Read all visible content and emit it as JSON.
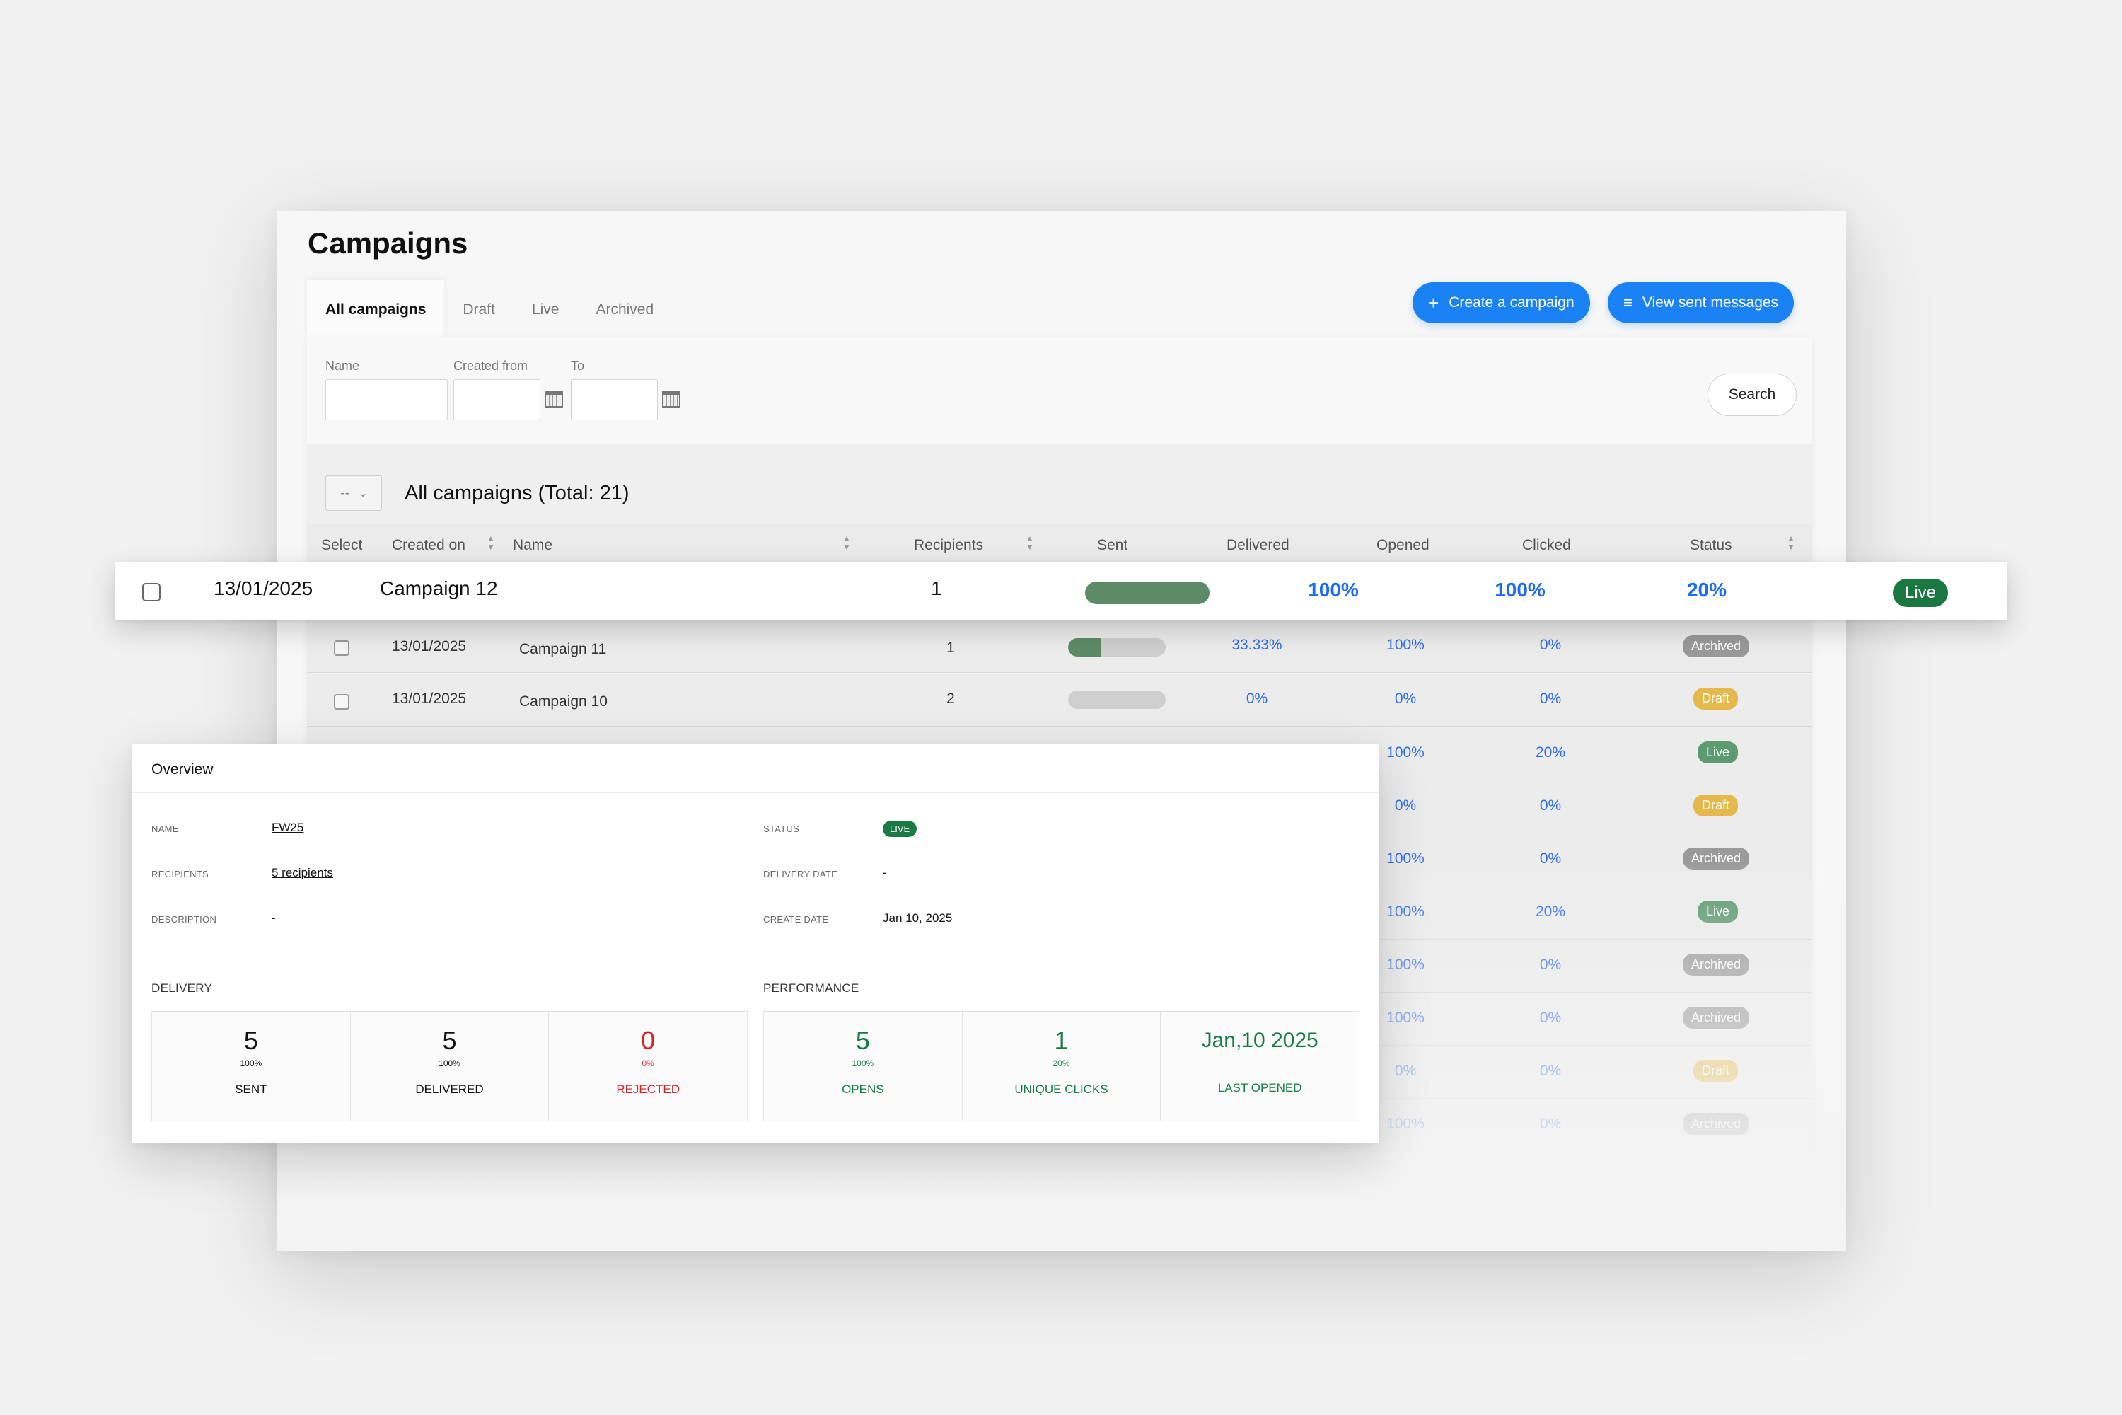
{
  "page": {
    "title": "Campaigns",
    "tabs": [
      {
        "label": "All campaigns",
        "active": true
      },
      {
        "label": "Draft"
      },
      {
        "label": "Live"
      },
      {
        "label": "Archived"
      }
    ],
    "create_label": "Create a campaign",
    "view_sent_label": "View sent messages",
    "accent_color": "#1a82f4"
  },
  "filter": {
    "name_label": "Name",
    "created_from_label": "Created from",
    "to_label": "To",
    "name_value": "",
    "created_from_value": "",
    "to_value": "",
    "search_label": "Search"
  },
  "list": {
    "bulk_select_value": "--",
    "title": "All campaigns (Total: 21)",
    "columns": [
      "Select",
      "Created on",
      "Name",
      "Recipients",
      "Sent",
      "Delivered",
      "Opened",
      "Clicked",
      "Status"
    ]
  },
  "highlight_row": {
    "created_on": "13/01/2025",
    "name": "Campaign 12",
    "recipients": "1",
    "sent_progress": 1.0,
    "delivered": "100%",
    "opened": "100%",
    "clicked": "20%",
    "status": "Live"
  },
  "rows": [
    {
      "created_on": "13/01/2025",
      "name": "Campaign 11",
      "recipients": "1",
      "sent_progress": 0.33,
      "delivered": "33.33%",
      "opened": "100%",
      "clicked": "0%",
      "status": "Archived"
    },
    {
      "created_on": "13/01/2025",
      "name": "Campaign 10",
      "recipients": "2",
      "sent_progress": 0,
      "delivered": "0%",
      "opened": "0%",
      "clicked": "0%",
      "status": "Draft"
    },
    {
      "opened": "100%",
      "clicked": "20%",
      "status": "Live"
    },
    {
      "opened": "0%",
      "clicked": "0%",
      "status": "Draft"
    },
    {
      "opened": "100%",
      "clicked": "0%",
      "status": "Archived"
    },
    {
      "opened": "100%",
      "clicked": "20%",
      "status": "Live"
    },
    {
      "opened": "100%",
      "clicked": "0%",
      "status": "Archived"
    },
    {
      "opened": "100%",
      "clicked": "0%",
      "status": "Archived"
    },
    {
      "opened": "0%",
      "clicked": "0%",
      "status": "Draft"
    },
    {
      "opened": "100%",
      "clicked": "0%",
      "status": "Archived"
    }
  ],
  "overview": {
    "title": "Overview",
    "name_label": "NAME",
    "name_value": "FW25",
    "recipients_label": "RECIPIENTS",
    "recipients_value": "5 recipients",
    "description_label": "DESCRIPTION",
    "description_value": "-",
    "status_label": "STATUS",
    "status_value": "LIVE",
    "delivery_date_label": "DELIVERY DATE",
    "delivery_date_value": "-",
    "create_date_label": "CREATE DATE",
    "create_date_value": "Jan 10, 2025",
    "delivery_section": "DELIVERY",
    "performance_section": "PERFORMANCE",
    "delivery_stats": [
      {
        "value": "5",
        "pct": "100%",
        "label": "SENT"
      },
      {
        "value": "5",
        "pct": "100%",
        "label": "DELIVERED"
      },
      {
        "value": "0",
        "pct": "0%",
        "label": "REJECTED"
      }
    ],
    "performance_stats": [
      {
        "value": "5",
        "pct": "100%",
        "label": "OPENS"
      },
      {
        "value": "1",
        "pct": "20%",
        "label": "UNIQUE CLICKS"
      },
      {
        "value": "Jan,10 2025",
        "label": "LAST OPENED"
      }
    ]
  }
}
